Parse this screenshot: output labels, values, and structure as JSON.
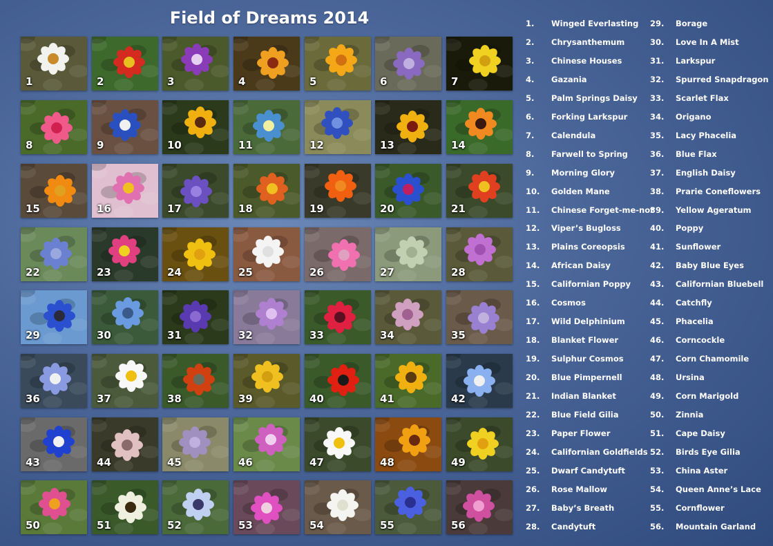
{
  "title": "Field of Dreams 2014",
  "flowers": [
    {
      "n": "1",
      "name": "Winged Everlasting",
      "bg": "#5a5a3a",
      "petal": "#f2f2ee",
      "center": "#c98a2a"
    },
    {
      "n": "2",
      "name": "Chrysanthemum",
      "bg": "#3d6a2c",
      "petal": "#d42a1f",
      "center": "#e8c020"
    },
    {
      "n": "3",
      "name": "Chinese Houses",
      "bg": "#4a5a2a",
      "petal": "#8a3cb8",
      "center": "#e6d0f0"
    },
    {
      "n": "4",
      "name": "Gazania",
      "bg": "#4a3a1a",
      "petal": "#f0a020",
      "center": "#8a2a10"
    },
    {
      "n": "5",
      "name": "Palm Springs Daisy",
      "bg": "#6a6a3a",
      "petal": "#f4a818",
      "center": "#d07010"
    },
    {
      "n": "6",
      "name": "Forking Larkspur",
      "bg": "#6a6a5a",
      "petal": "#8a6ac0",
      "center": "#c0b0e0"
    },
    {
      "n": "7",
      "name": "Calendula",
      "bg": "#1a1a0a",
      "petal": "#f0d020",
      "center": "#d0a010"
    },
    {
      "n": "8",
      "name": "Farwell to Spring",
      "bg": "#4a6a2a",
      "petal": "#f05a8a",
      "center": "#d02050"
    },
    {
      "n": "9",
      "name": "Morning Glory",
      "bg": "#6a5040",
      "petal": "#2a50c0",
      "center": "#f0f0f0"
    },
    {
      "n": "10",
      "name": "Golden Mane",
      "bg": "#2a3a1a",
      "petal": "#f0b010",
      "center": "#5a2a10"
    },
    {
      "n": "11",
      "name": "Chinese Forget-me-not",
      "bg": "#4a6a3a",
      "petal": "#4a90d0",
      "center": "#f0f0a0"
    },
    {
      "n": "12",
      "name": "Viper’s Bugloss",
      "bg": "#8a8a5a",
      "petal": "#3050c0",
      "center": "#7090e0"
    },
    {
      "n": "13",
      "name": "Plains Coreopsis",
      "bg": "#2a2a1a",
      "petal": "#f0b010",
      "center": "#7a1a10"
    },
    {
      "n": "14",
      "name": "African Daisy",
      "bg": "#3a6a2a",
      "petal": "#f08a20",
      "center": "#3a1a10"
    },
    {
      "n": "15",
      "name": "Californian Poppy",
      "bg": "#5a4a3a",
      "petal": "#f08a10",
      "center": "#e0a020"
    },
    {
      "n": "16",
      "name": "Cosmos",
      "bg": "#e0c0d0",
      "petal": "#e070b0",
      "center": "#f0c020"
    },
    {
      "n": "17",
      "name": "Wild Delphinium",
      "bg": "#3a4a2a",
      "petal": "#6a50c0",
      "center": "#9a80e0"
    },
    {
      "n": "18",
      "name": "Blanket Flower",
      "bg": "#4a5a2a",
      "petal": "#e06020",
      "center": "#f0c020"
    },
    {
      "n": "19",
      "name": "Sulphur Cosmos",
      "bg": "#3a3a2a",
      "petal": "#f06010",
      "center": "#f08a20"
    },
    {
      "n": "20",
      "name": "Blue Pimpernell",
      "bg": "#3a5a2a",
      "petal": "#2a50d0",
      "center": "#c02060"
    },
    {
      "n": "21",
      "name": "Indian Blanket",
      "bg": "#3a4a2a",
      "petal": "#e04020",
      "center": "#f0c020"
    },
    {
      "n": "22",
      "name": "Blue Field Gilia",
      "bg": "#6a8a5a",
      "petal": "#6a80d0",
      "center": "#9aa8e0"
    },
    {
      "n": "23",
      "name": "Paper Flower",
      "bg": "#2a3a2a",
      "petal": "#e04080",
      "center": "#f0d020"
    },
    {
      "n": "24",
      "name": "Californian Goldfields",
      "bg": "#6a5010",
      "petal": "#f0c010",
      "center": "#e0a010"
    },
    {
      "n": "25",
      "name": "Dwarf Candytuft",
      "bg": "#8a5a40",
      "petal": "#f4f4f4",
      "center": "#e0e0e0"
    },
    {
      "n": "26",
      "name": "Rose Mallow",
      "bg": "#7a6a6a",
      "petal": "#f070b0",
      "center": "#e0a0c0"
    },
    {
      "n": "27",
      "name": "Baby’s Breath",
      "bg": "#8a9a7a",
      "petal": "#c0d0b0",
      "center": "#a0b090"
    },
    {
      "n": "28",
      "name": "Candytuft",
      "bg": "#5a5a3a",
      "petal": "#c070d0",
      "center": "#a050b0"
    },
    {
      "n": "29",
      "name": "Borage",
      "bg": "#6a9ad0",
      "petal": "#2a50d0",
      "center": "#2a2a3a"
    },
    {
      "n": "30",
      "name": "Love In A Mist",
      "bg": "#3a5a3a",
      "petal": "#6a9ae0",
      "center": "#3a5a8a"
    },
    {
      "n": "31",
      "name": "Larkspur",
      "bg": "#2a3a1a",
      "petal": "#5a3ab0",
      "center": "#8a6ad0"
    },
    {
      "n": "32",
      "name": "Spurred Snapdragon",
      "bg": "#8a7a9a",
      "petal": "#b080d0",
      "center": "#e0c0f0"
    },
    {
      "n": "33",
      "name": "Scarlet Flax",
      "bg": "#3a5a2a",
      "petal": "#e02040",
      "center": "#5a1020"
    },
    {
      "n": "34",
      "name": "Origano",
      "bg": "#5a5a3a",
      "petal": "#d0a0c0",
      "center": "#a06090"
    },
    {
      "n": "35",
      "name": "Lacy Phacelia",
      "bg": "#6a5a4a",
      "petal": "#9a80d0",
      "center": "#c0b0e0"
    },
    {
      "n": "36",
      "name": "Blue Flax",
      "bg": "#3a4a5a",
      "petal": "#8a9ae0",
      "center": "#f0f0f0"
    },
    {
      "n": "37",
      "name": "English Daisy",
      "bg": "#4a5a3a",
      "petal": "#f8f8f8",
      "center": "#f0c010"
    },
    {
      "n": "38",
      "name": "Prarie Coneflowers",
      "bg": "#3a5a2a",
      "petal": "#d04010",
      "center": "#6a6a5a"
    },
    {
      "n": "39",
      "name": "Yellow Ageratum",
      "bg": "#5a5a2a",
      "petal": "#f0c020",
      "center": "#d0a010"
    },
    {
      "n": "40",
      "name": "Poppy",
      "bg": "#3a5a2a",
      "petal": "#e02010",
      "center": "#1a1a1a"
    },
    {
      "n": "41",
      "name": "Sunflower",
      "bg": "#4a6a2a",
      "petal": "#f0b010",
      "center": "#5a3a10"
    },
    {
      "n": "42",
      "name": "Baby Blue Eyes",
      "bg": "#2a3a4a",
      "petal": "#8ab0f0",
      "center": "#f0f0f0"
    },
    {
      "n": "43",
      "name": "Californian Bluebell",
      "bg": "#6a6a6a",
      "petal": "#2040d0",
      "center": "#f0f0f0"
    },
    {
      "n": "44",
      "name": "Catchfly",
      "bg": "#3a3a2a",
      "petal": "#e0c0c0",
      "center": "#8a6a6a"
    },
    {
      "n": "45",
      "name": "Phacelia",
      "bg": "#8a8a6a",
      "petal": "#a090c0",
      "center": "#c0b0e0"
    },
    {
      "n": "46",
      "name": "Corncockle",
      "bg": "#6a8a4a",
      "petal": "#d060c0",
      "center": "#f0d0f0"
    },
    {
      "n": "47",
      "name": "Corn Chamomile",
      "bg": "#3a4a2a",
      "petal": "#f8f8f8",
      "center": "#f0c010"
    },
    {
      "n": "48",
      "name": "Ursina",
      "bg": "#8a4a10",
      "petal": "#f0a010",
      "center": "#6a2a10"
    },
    {
      "n": "49",
      "name": "Corn Marigold",
      "bg": "#3a4a2a",
      "petal": "#f0d020",
      "center": "#e0a010"
    },
    {
      "n": "50",
      "name": "Zinnia",
      "bg": "#5a7a3a",
      "petal": "#e05090",
      "center": "#f0a020"
    },
    {
      "n": "51",
      "name": "Cape Daisy",
      "bg": "#3a5a2a",
      "petal": "#f0f0e0",
      "center": "#3a2a10"
    },
    {
      "n": "52",
      "name": "Birds Eye Gilia",
      "bg": "#4a6a3a",
      "petal": "#c0d0f0",
      "center": "#3a3a6a"
    },
    {
      "n": "53",
      "name": "China  Aster",
      "bg": "#6a4a5a",
      "petal": "#e050c0",
      "center": "#f0d0e0"
    },
    {
      "n": "54",
      "name": "Queen Anne’s Lace",
      "bg": "#6a5a4a",
      "petal": "#f4f4f0",
      "center": "#e0e0d0"
    },
    {
      "n": "55",
      "name": "Cornflower",
      "bg": "#4a5a3a",
      "petal": "#4a60e0",
      "center": "#2a3090"
    },
    {
      "n": "56",
      "name": "Mountain Garland",
      "bg": "#4a3a3a",
      "petal": "#d050a0",
      "center": "#f0a0d0"
    }
  ]
}
